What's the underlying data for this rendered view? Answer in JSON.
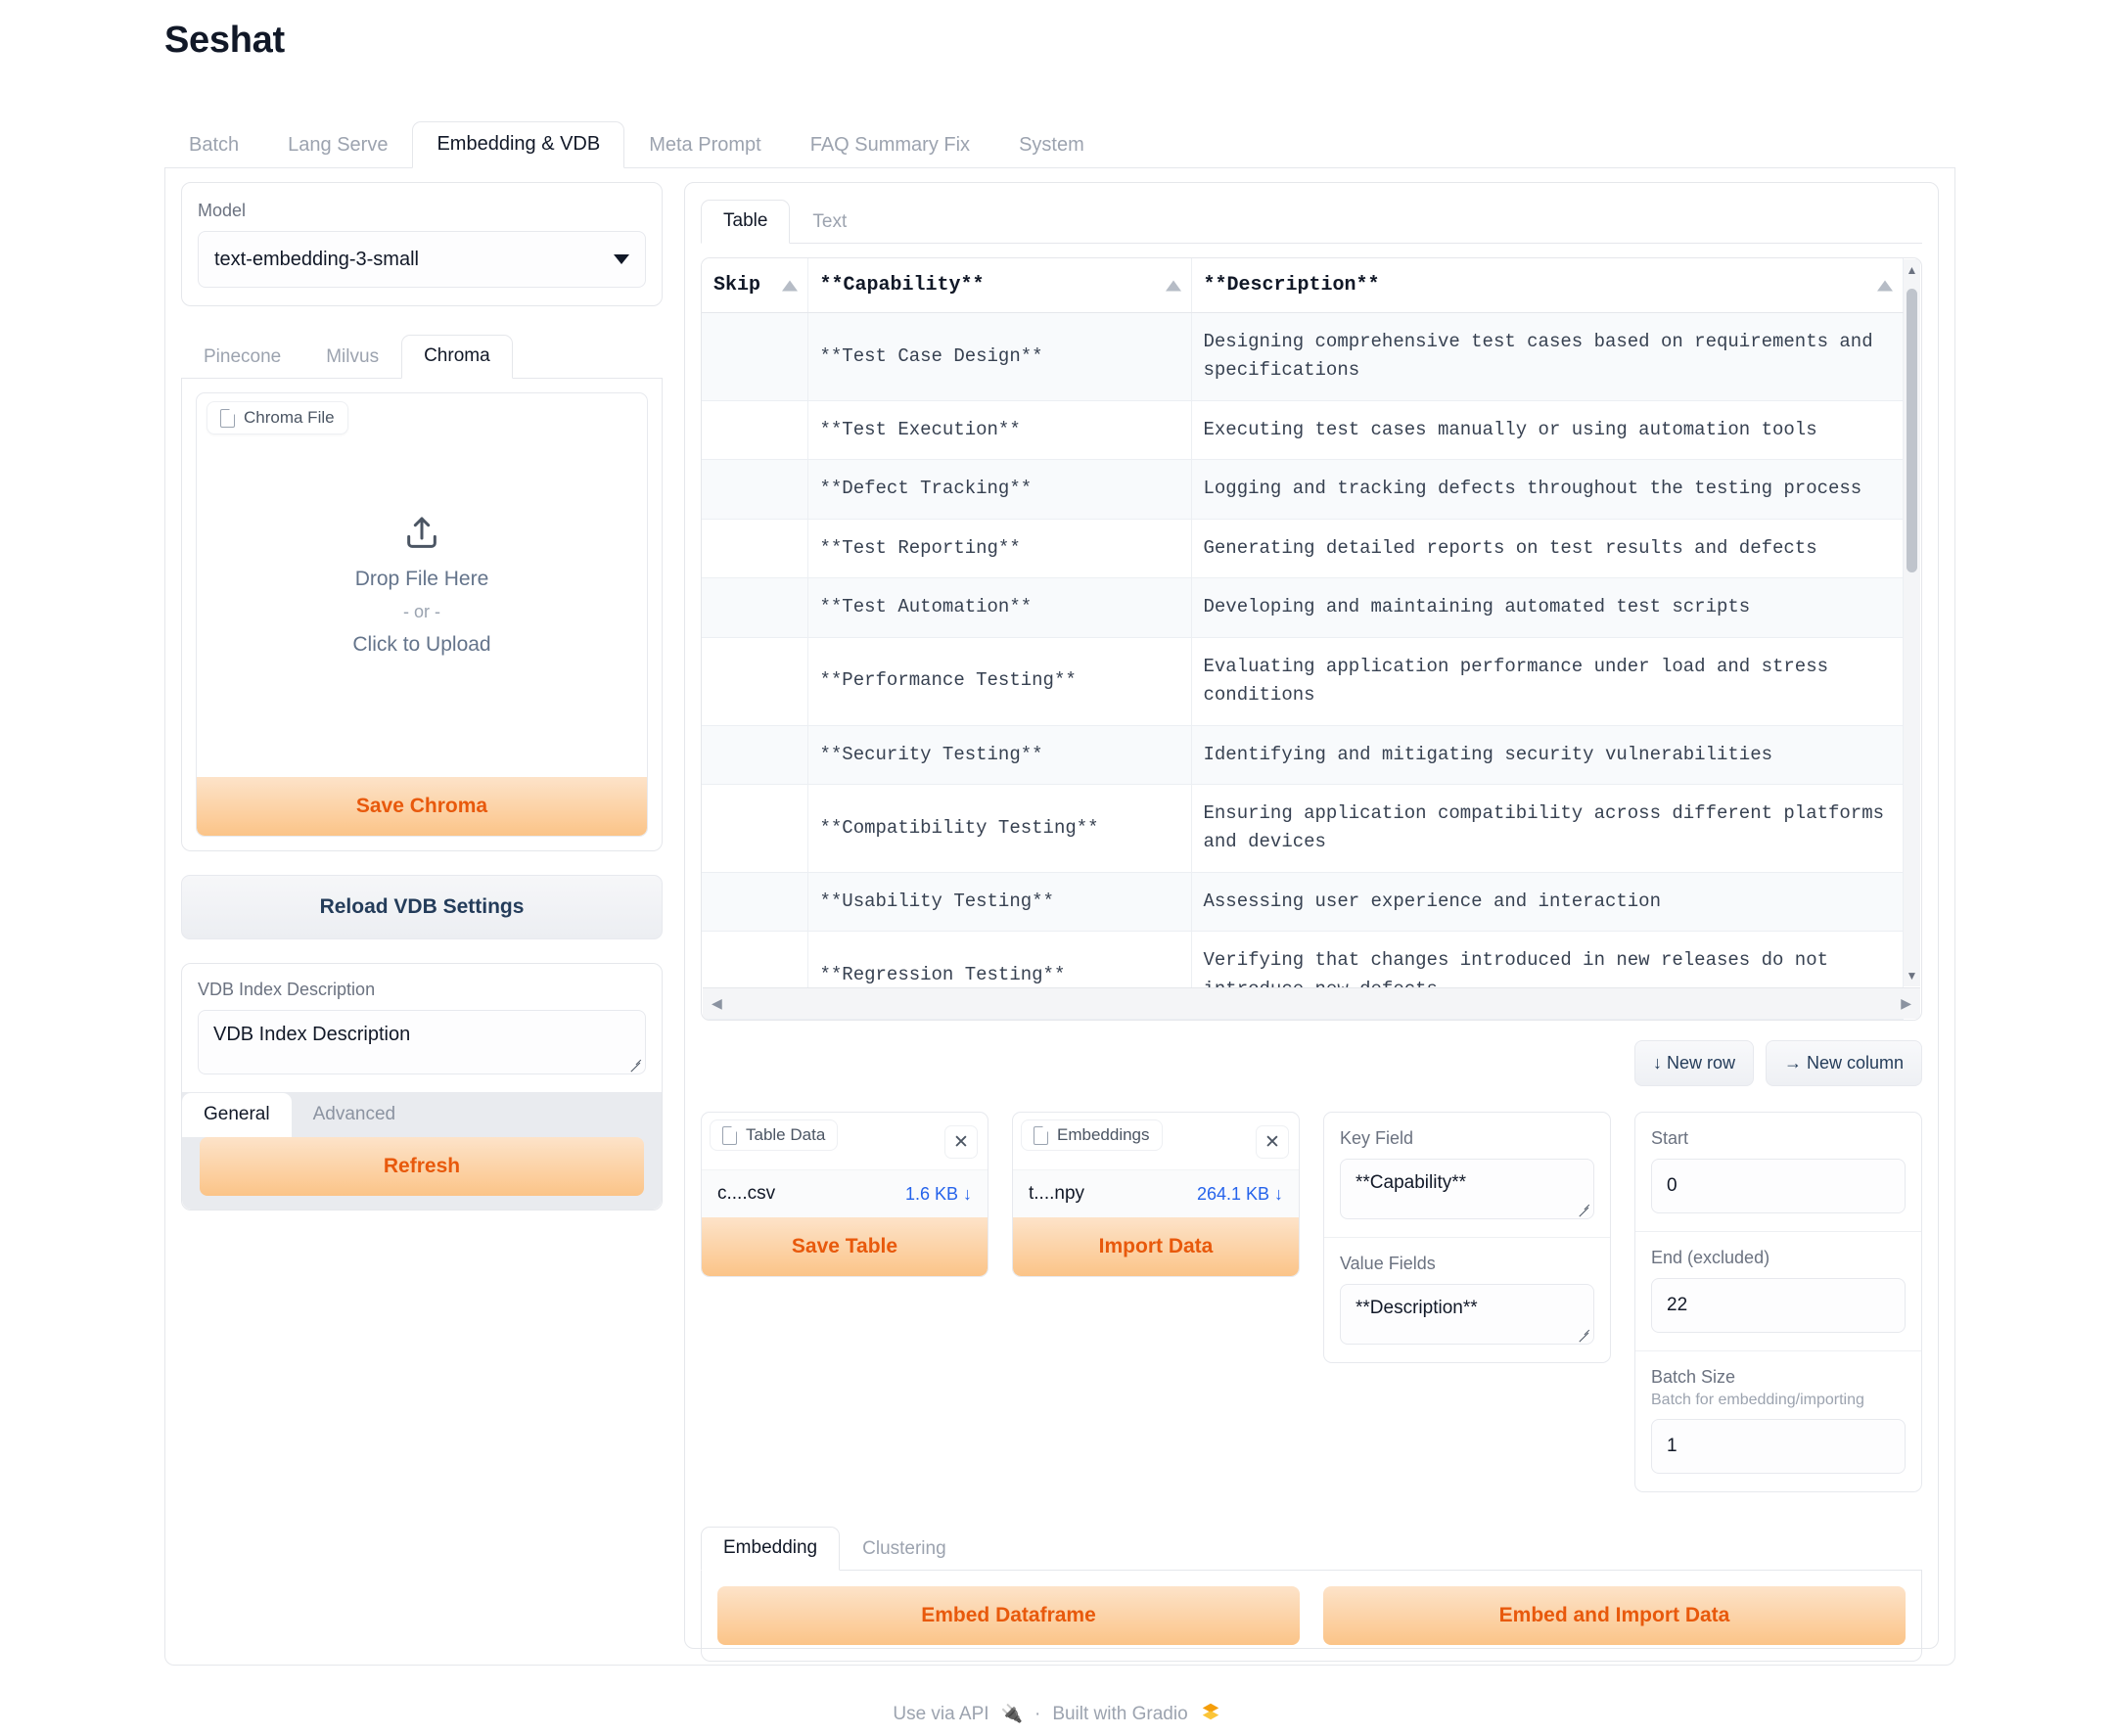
{
  "app": {
    "title": "Seshat"
  },
  "top_tabs": [
    {
      "label": "Batch",
      "active": false
    },
    {
      "label": "Lang Serve",
      "active": false
    },
    {
      "label": "Embedding & VDB",
      "active": true
    },
    {
      "label": "Meta Prompt",
      "active": false
    },
    {
      "label": "FAQ Summary Fix",
      "active": false
    },
    {
      "label": "System",
      "active": false
    }
  ],
  "left": {
    "model": {
      "label": "Model",
      "value": "text-embedding-3-small"
    },
    "provider_tabs": [
      {
        "label": "Pinecone",
        "active": false
      },
      {
        "label": "Milvus",
        "active": false
      },
      {
        "label": "Chroma",
        "active": true
      }
    ],
    "upload": {
      "header": "Chroma File",
      "drop_text": "Drop File Here",
      "or_text": "- or -",
      "click_text": "Click to Upload",
      "save_label": "Save Chroma"
    },
    "reload_label": "Reload VDB Settings",
    "description": {
      "label": "VDB Index Description",
      "value": "VDB Index Description"
    },
    "sub_tabs": [
      {
        "label": "General",
        "active": true
      },
      {
        "label": "Advanced",
        "active": false
      }
    ],
    "refresh_label": "Refresh"
  },
  "right": {
    "data_tabs": [
      {
        "label": "Table",
        "active": true
      },
      {
        "label": "Text",
        "active": false
      }
    ],
    "row_buttons": {
      "new_row": "↓ New row",
      "new_column": "→ New column"
    },
    "files": [
      {
        "header": "Table Data",
        "filename": "c....csv",
        "size": "1.6 KB ↓",
        "action": "Save Table",
        "close": "✕"
      },
      {
        "header": "Embeddings",
        "filename": "t....npy",
        "size": "264.1 KB ↓",
        "action": "Import Data",
        "close": "✕"
      }
    ],
    "fields": {
      "key_field": {
        "label": "Key Field",
        "value": "**Capability**"
      },
      "value_fields": {
        "label": "Value Fields",
        "value": "**Description**"
      }
    },
    "range": {
      "start": {
        "label": "Start",
        "value": "0"
      },
      "end": {
        "label": "End (excluded)",
        "value": "22"
      },
      "batch": {
        "label": "Batch Size",
        "hint": "Batch for embedding/importing",
        "value": "1"
      }
    },
    "bottom_tabs": [
      {
        "label": "Embedding",
        "active": true
      },
      {
        "label": "Clustering",
        "active": false
      }
    ],
    "bottom_buttons": {
      "embed_dataframe": "Embed Dataframe",
      "embed_and_import": "Embed and Import Data"
    }
  },
  "table": {
    "columns": [
      "Skip",
      "**Capability**",
      "**Description**"
    ],
    "rows": [
      {
        "skip": "",
        "capability": "**Test Case Design**",
        "description": "Designing comprehensive test cases based on requirements and specifications"
      },
      {
        "skip": "",
        "capability": "**Test Execution**",
        "description": "Executing test cases manually or using automation tools"
      },
      {
        "skip": "",
        "capability": "**Defect Tracking**",
        "description": "Logging and tracking defects throughout the testing process"
      },
      {
        "skip": "",
        "capability": "**Test Reporting**",
        "description": "Generating detailed reports on test results and defects"
      },
      {
        "skip": "",
        "capability": "**Test Automation**",
        "description": "Developing and maintaining automated test scripts"
      },
      {
        "skip": "",
        "capability": "**Performance Testing**",
        "description": "Evaluating application performance under load and stress conditions"
      },
      {
        "skip": "",
        "capability": "**Security Testing**",
        "description": "Identifying and mitigating security vulnerabilities"
      },
      {
        "skip": "",
        "capability": "**Compatibility Testing**",
        "description": "Ensuring application compatibility across different platforms and devices"
      },
      {
        "skip": "",
        "capability": "**Usability Testing**",
        "description": "Assessing user experience and interaction"
      },
      {
        "skip": "",
        "capability": "**Regression Testing**",
        "description": "Verifying that changes introduced in new releases do not introduce new defects"
      }
    ]
  },
  "footer": {
    "api_label": "Use via API",
    "dot": "·",
    "gradio_label": "Built with Gradio"
  },
  "colors": {
    "accent_orange": "#e8590c",
    "link_blue": "#2563eb"
  }
}
